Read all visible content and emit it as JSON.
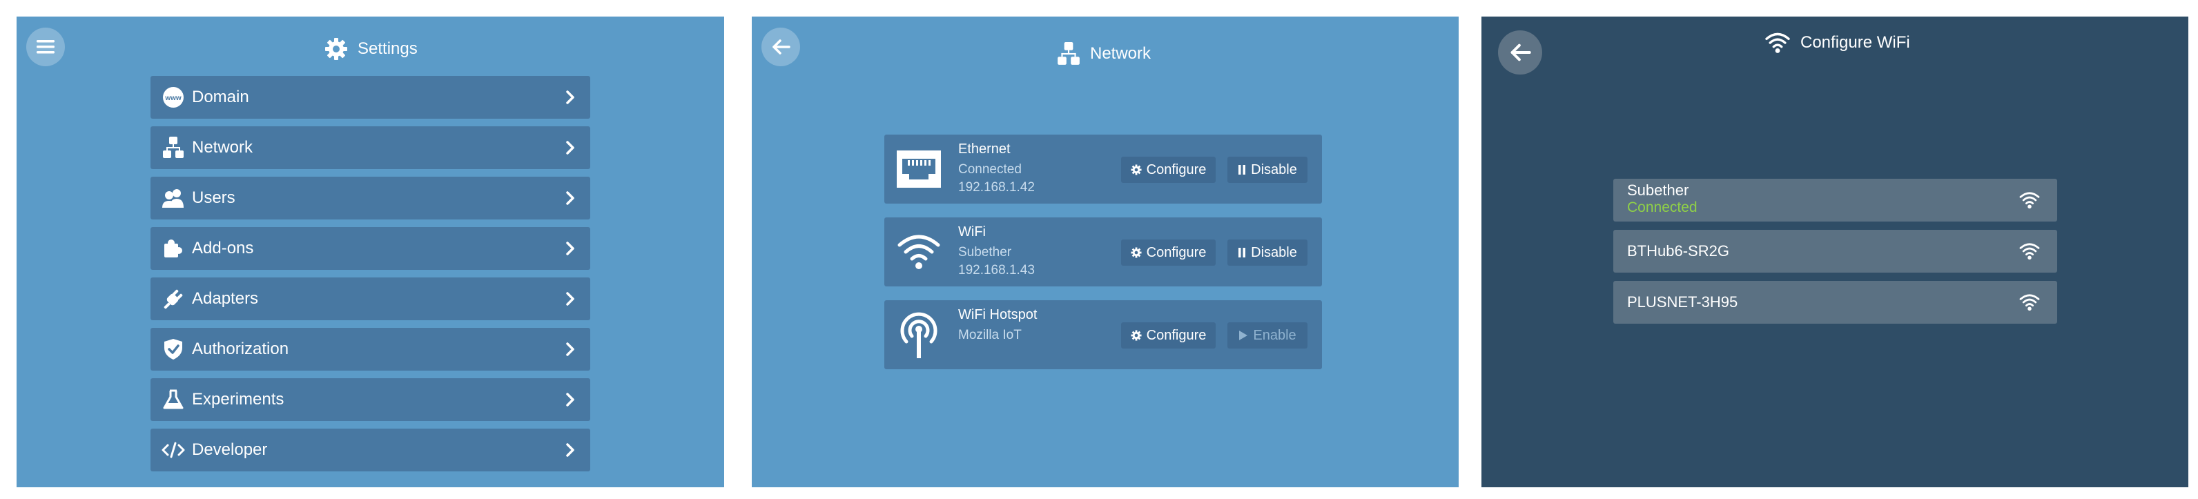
{
  "settings": {
    "title": "Settings",
    "menu_button_icon": "hamburger-menu-icon",
    "title_icon": "gear-icon",
    "items": [
      {
        "label": "Domain",
        "icon": "www-globe-icon"
      },
      {
        "label": "Network",
        "icon": "network-icon"
      },
      {
        "label": "Users",
        "icon": "users-icon"
      },
      {
        "label": "Add-ons",
        "icon": "puzzle-icon"
      },
      {
        "label": "Adapters",
        "icon": "plug-icon"
      },
      {
        "label": "Authorization",
        "icon": "shield-check-icon"
      },
      {
        "label": "Experiments",
        "icon": "flask-icon"
      },
      {
        "label": "Developer",
        "icon": "code-icon"
      }
    ]
  },
  "network": {
    "title": "Network",
    "title_icon": "network-icon",
    "back_icon": "back-arrow-icon",
    "interfaces": [
      {
        "name": "Ethernet",
        "line1": "Connected",
        "line2": "192.168.1.42",
        "icon": "ethernet-port-icon",
        "configure_label": "Configure",
        "toggle_label": "Disable",
        "toggle_enabled": true
      },
      {
        "name": "WiFi",
        "line1": "Subether",
        "line2": "192.168.1.43",
        "icon": "wifi-icon",
        "configure_label": "Configure",
        "toggle_label": "Disable",
        "toggle_enabled": true
      },
      {
        "name": "WiFi Hotspot",
        "line1": "Mozilla IoT",
        "line2": "",
        "icon": "hotspot-antenna-icon",
        "configure_label": "Configure",
        "toggle_label": "Enable",
        "toggle_enabled": false
      }
    ]
  },
  "wifi": {
    "title": "Configure WiFi",
    "title_icon": "wifi-icon",
    "back_icon": "back-arrow-icon",
    "networks": [
      {
        "ssid": "Subether",
        "status": "Connected",
        "icon": "wifi-signal-icon"
      },
      {
        "ssid": "BTHub6-SR2G",
        "status": "",
        "icon": "wifi-signal-icon"
      },
      {
        "ssid": "PLUSNET-3H95",
        "status": "",
        "icon": "wifi-signal-icon"
      }
    ]
  },
  "colors": {
    "panel_light": "#5b9bc8",
    "panel_dark": "#2f4d66",
    "item_bg": "#4878a2",
    "connected_green": "#8fd047"
  }
}
